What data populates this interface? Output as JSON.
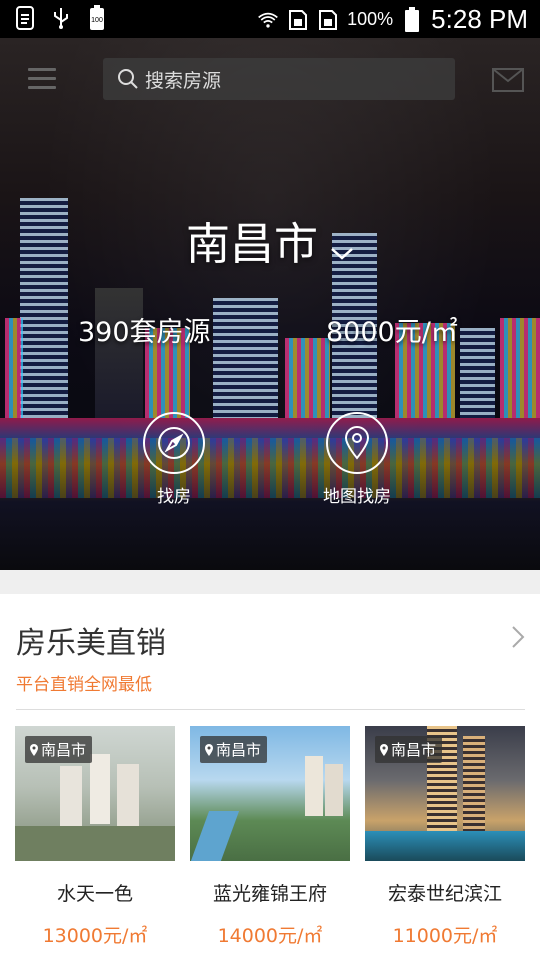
{
  "status_bar": {
    "battery_percent": "100%",
    "time": "5:28 PM",
    "left_icons": [
      "document-icon",
      "usb-icon",
      "battery-full-icon"
    ],
    "right_icons": [
      "wifi-icon",
      "sim1-icon",
      "sim2-icon",
      "battery-icon"
    ]
  },
  "header": {
    "search_placeholder": "搜索房源"
  },
  "hero": {
    "city": "南昌市",
    "listings_count": "390套房源",
    "avg_price": "8000元/㎡",
    "actions": [
      {
        "label": "找房",
        "icon": "compass-icon"
      },
      {
        "label": "地图找房",
        "icon": "map-pin-icon"
      }
    ]
  },
  "section": {
    "title": "房乐美直销",
    "subtitle": "平台直销全网最低",
    "accent": "#f07a33"
  },
  "cards": [
    {
      "location": "南昌市",
      "name": "水天一色",
      "price": "13000元/㎡"
    },
    {
      "location": "南昌市",
      "name": "蓝光雍锦王府",
      "price": "14000元/㎡"
    },
    {
      "location": "南昌市",
      "name": "宏泰世纪滨江",
      "price": "11000元/㎡"
    }
  ]
}
